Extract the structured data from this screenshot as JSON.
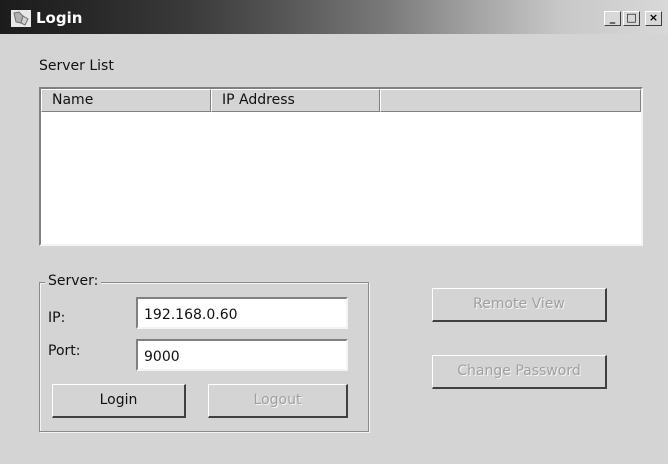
{
  "window": {
    "title": "Login",
    "app_icon": "app-icon",
    "controls": {
      "minimize": "_",
      "maximize": "□",
      "close": "×"
    }
  },
  "server_list": {
    "label": "Server List",
    "columns": [
      "Name",
      "IP Address",
      ""
    ],
    "rows": []
  },
  "server_group": {
    "label": "Server:",
    "ip_label": "IP:",
    "ip_value": "192.168.0.60",
    "port_label": "Port:",
    "port_value": "9000"
  },
  "buttons": {
    "login": "Login",
    "logout": "Logout",
    "remote_view": "Remote View",
    "change_password": "Change Password"
  },
  "states": {
    "logout_enabled": false,
    "remote_view_enabled": false,
    "change_password_enabled": false
  }
}
